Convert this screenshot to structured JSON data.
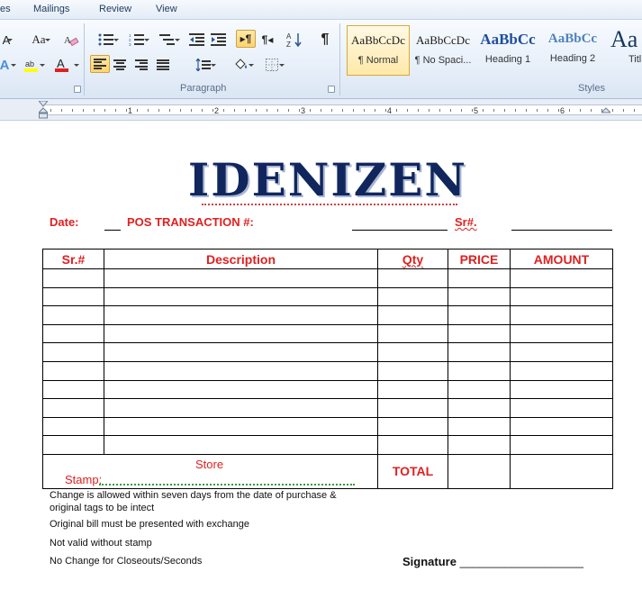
{
  "menu": [
    "es",
    "Mailings",
    "Review",
    "View"
  ],
  "ribbon": {
    "paragraph_label": "Paragraph",
    "styles_label": "Styles",
    "font_size_glyph": "Aa",
    "change_case_glyph": "Aa",
    "pilcrow": "¶",
    "styles": [
      {
        "sample": "AaBbCcDc",
        "name": "¶ Normal"
      },
      {
        "sample": "AaBbCcDc",
        "name": "¶ No Spaci..."
      },
      {
        "sample": "AaBbCc",
        "name": "Heading 1"
      },
      {
        "sample": "AaBbCc",
        "name": "Heading 2"
      },
      {
        "sample": "Aa",
        "name": "Title"
      }
    ],
    "colors": {
      "accent": "#1f4e9c",
      "highlight": "#ffff00",
      "font_color": "#e02020"
    }
  },
  "ruler": {
    "numbers": [
      "1",
      "2",
      "3",
      "4",
      "5",
      "6"
    ]
  },
  "document": {
    "logo": "IDENIZEN",
    "date_label": "Date:",
    "pos_label": "POS TRANSACTION #:",
    "sr_label": "Sr#.",
    "table": {
      "headers": [
        "Sr.#",
        "Description",
        "Qty",
        "PRICE",
        "AMOUNT"
      ],
      "empty_rows": 10,
      "store_label": "Store",
      "stamp_label": "Stamp:",
      "total_label": "TOTAL"
    },
    "notes": [
      "Change  is allowed within seven days from the date of purchase & original tags to be intect",
      "Original bill must be presented with exchange",
      "Not valid without stamp",
      "No Change for Closeouts/Seconds"
    ],
    "signature_label": "Signature",
    "signature_line": "___________________"
  }
}
